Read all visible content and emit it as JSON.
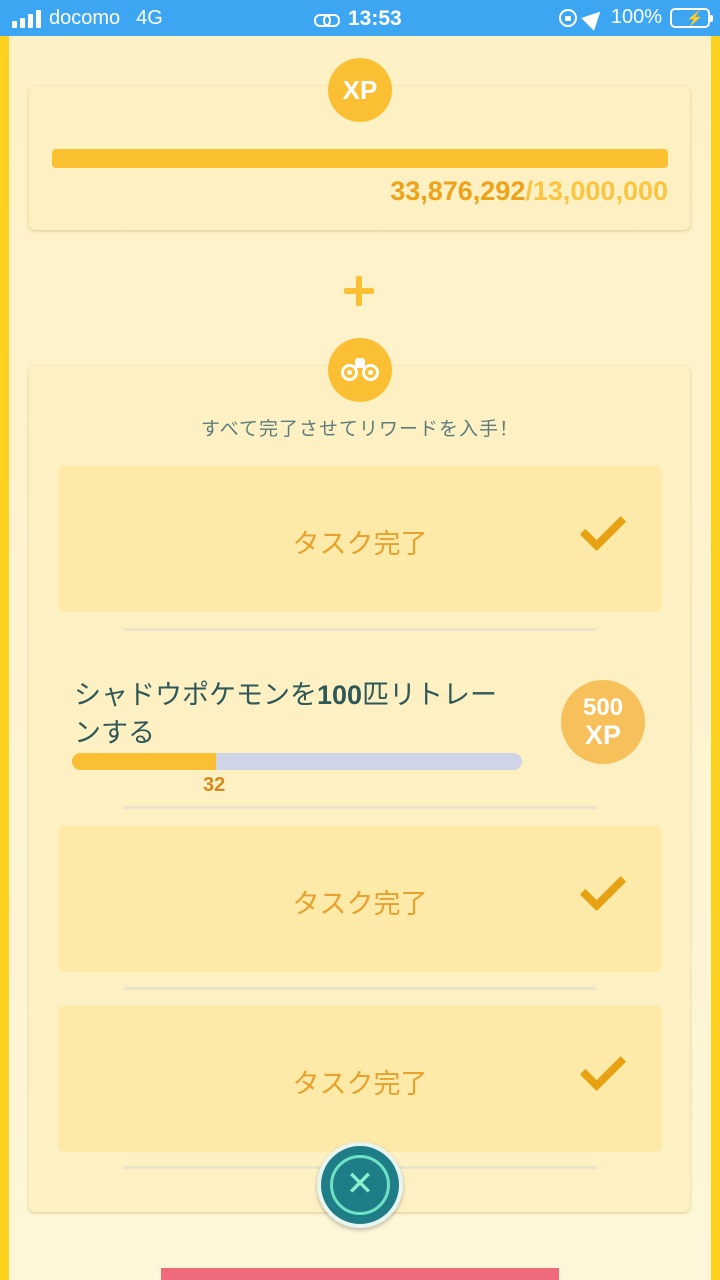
{
  "status_bar": {
    "carrier": "docomo",
    "network": "4G",
    "time": "13:53",
    "battery": "100%"
  },
  "xp_goal": {
    "badge": "XP",
    "current": "33,876,292",
    "separator": "/",
    "goal": "13,000,000",
    "progress": 1.0
  },
  "subtitle": "すべて完了させてリワードを入手！",
  "tasks": [
    {
      "label": "タスク完了",
      "done": true
    },
    {
      "title_pre": "シャドウポケモンを",
      "title_num": "100",
      "title_post": "匹リトレーンする",
      "progress_value": "32",
      "progress": 0.32,
      "reward_amount": "500",
      "reward_unit": "XP"
    },
    {
      "label": "タスク完了",
      "done": true
    },
    {
      "label": "タスク完了",
      "done": true
    }
  ],
  "close_glyph": "✕",
  "colors": {
    "accent": "#fbbf33",
    "done_text": "#e7a12c",
    "teal": "#1e7d86"
  }
}
